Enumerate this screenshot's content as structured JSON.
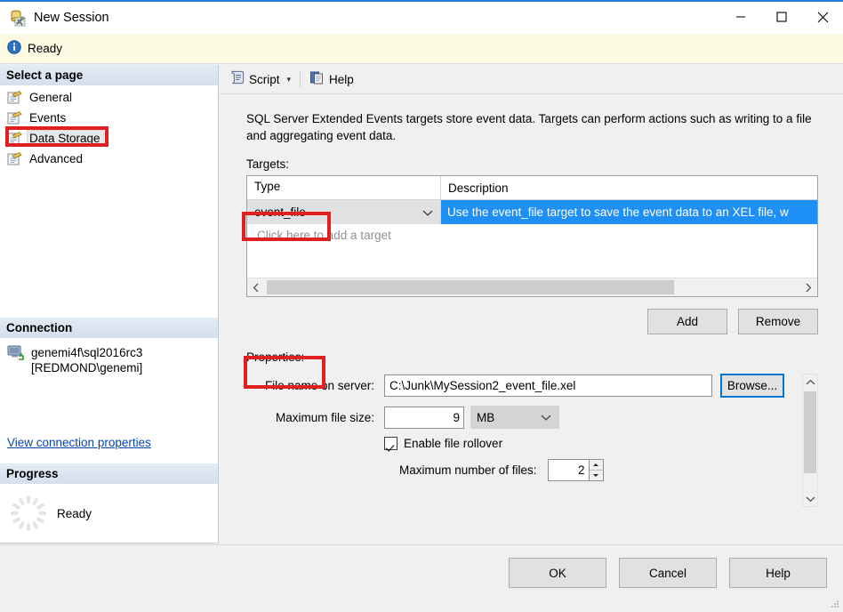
{
  "window": {
    "title": "New Session",
    "icon": "session-db-tools-icon",
    "controls": {
      "minimize": "minimize-icon",
      "maximize": "maximize-icon",
      "close": "close-icon"
    }
  },
  "status_bar": {
    "icon": "info-icon",
    "text": "Ready",
    "background": "#fdfbe3"
  },
  "sidebar": {
    "select_page_header": "Select a page",
    "pages": [
      {
        "label": "General",
        "selected": false
      },
      {
        "label": "Events",
        "selected": false
      },
      {
        "label": "Data Storage",
        "selected": true
      },
      {
        "label": "Advanced",
        "selected": false
      }
    ],
    "connection": {
      "header": "Connection",
      "server": "genemi4f\\sql2016rc3",
      "user": "[REDMOND\\genemi]",
      "link": "View connection properties"
    },
    "progress": {
      "header": "Progress",
      "text": "Ready"
    }
  },
  "toolbar": {
    "script_label": "Script",
    "script_icon": "script-icon",
    "script_caret": "▾",
    "help_label": "Help",
    "help_icon": "help-pages-icon"
  },
  "main": {
    "description": "SQL Server Extended Events targets store event data. Targets can perform actions such as writing to a file and aggregating event data.",
    "targets_label": "Targets:",
    "grid": {
      "columns": [
        "Type",
        "Description"
      ],
      "rows": [
        {
          "type": "event_file",
          "description": "Use the event_file target to save the event data to an XEL file, w"
        }
      ],
      "add_row_placeholder": "Click here to add a target",
      "selected_row_color": "#1e90f5"
    },
    "add_button": "Add",
    "remove_button": "Remove",
    "properties_label": "Properties:",
    "properties": {
      "file_name_label": "File name on server:",
      "file_name_value": "C:\\Junk\\MySession2_event_file.xel",
      "browse_button": "Browse...",
      "max_file_size_label": "Maximum file size:",
      "max_file_size_value": "9",
      "max_file_size_unit": "MB",
      "enable_rollover_label": "Enable file rollover",
      "enable_rollover_checked": true,
      "max_files_label": "Maximum number of files:",
      "max_files_value": "2"
    }
  },
  "footer": {
    "ok": "OK",
    "cancel": "Cancel",
    "help": "Help"
  },
  "annotations": {
    "highlight_color": "#e02020",
    "boxes": [
      "data-storage-page",
      "event-file-type-cell",
      "properties-label"
    ]
  }
}
